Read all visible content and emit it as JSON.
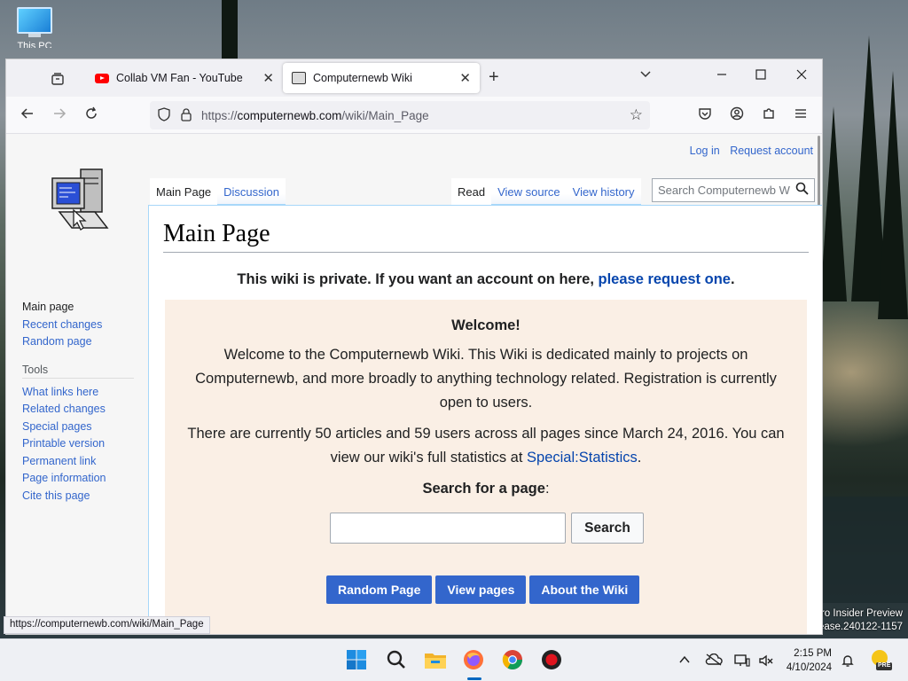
{
  "desktop": {
    "icon_label": "This PC",
    "watermark_line1": "ro Insider Preview",
    "watermark_line2": "lease.240122-1157"
  },
  "browser": {
    "tabs": [
      {
        "label": "Collab VM Fan - YouTube",
        "icon": "youtube-icon"
      },
      {
        "label": "Computernewb Wiki",
        "icon": "wiki-favicon"
      }
    ],
    "url_prefix": "https://",
    "url_host": "computernewb.com",
    "url_path": "/wiki/Main_Page",
    "status_url": "https://computernewb.com/wiki/Main_Page"
  },
  "wiki": {
    "personal": [
      "Log in",
      "Request account"
    ],
    "page_tabs": [
      "Main Page",
      "Discussion"
    ],
    "view_tabs": [
      "Read",
      "View source",
      "View history"
    ],
    "search_placeholder": "Search Computernewb W",
    "sidebar_nav": [
      "Main page",
      "Recent changes",
      "Random page"
    ],
    "tools_heading": "Tools",
    "tools": [
      "What links here",
      "Related changes",
      "Special pages",
      "Printable version",
      "Permanent link",
      "Page information",
      "Cite this page"
    ],
    "title": "Main Page",
    "notice_text": "This wiki is private. If you want an account on here, ",
    "notice_link": "please request one",
    "notice_end": ".",
    "welcome_heading": "Welcome!",
    "welcome_p1": "Welcome to the Computernewb Wiki. This Wiki is dedicated mainly to projects on Computernewb, and more broadly to anything technology related. Registration is currently open to users.",
    "stats_text": "There are currently 50 articles and 59 users across all pages since March 24, 2016. You can view our wiki's full statistics at ",
    "stats_link": "Special:Statistics",
    "stats_end": ".",
    "search_label": "Search for a page",
    "search_colon": ":",
    "search_button": "Search",
    "buttons": [
      "Random Page",
      "View pages",
      "About the Wiki"
    ]
  },
  "taskbar": {
    "time": "2:15 PM",
    "date": "4/10/2024",
    "badge": "PRE"
  },
  "colors": {
    "link": "#3366cc",
    "button_blue": "#3366cc",
    "welcome_bg": "#faefe5"
  }
}
